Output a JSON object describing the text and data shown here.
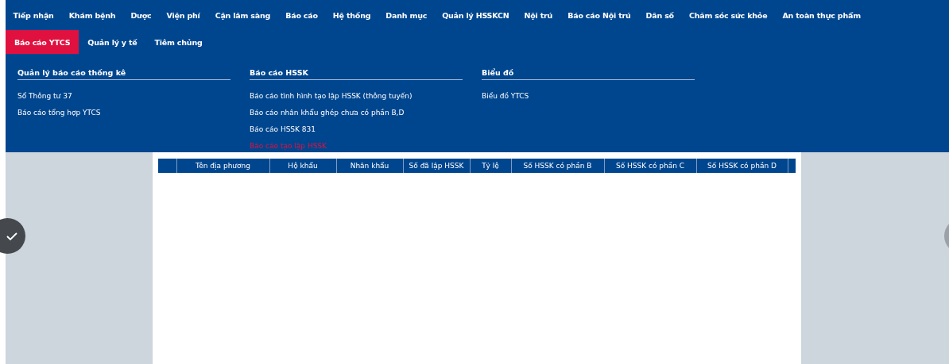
{
  "main_menu": [
    {
      "label": "Tiếp nhận",
      "selected": false
    },
    {
      "label": "Khám bệnh",
      "selected": false
    },
    {
      "label": "Dược",
      "selected": false
    },
    {
      "label": "Viện phí",
      "selected": false
    },
    {
      "label": "Cận lâm sàng",
      "selected": false
    },
    {
      "label": "Báo cáo",
      "selected": false
    },
    {
      "label": "Hệ thống",
      "selected": false
    },
    {
      "label": "Danh mục",
      "selected": false
    },
    {
      "label": "Quản lý HSSKCN",
      "selected": false
    },
    {
      "label": "Nội trú",
      "selected": false
    },
    {
      "label": "Báo cáo Nội trú",
      "selected": false
    },
    {
      "label": "Dân số",
      "selected": false
    },
    {
      "label": "Chăm sóc sức khỏe",
      "selected": false
    },
    {
      "label": "An toàn thực phẩm",
      "selected": false
    }
  ],
  "sub_menu": [
    {
      "label": "Báo cáo YTCS",
      "selected": true
    },
    {
      "label": "Quản lý y tế",
      "selected": false
    },
    {
      "label": "Tiêm chủng",
      "selected": false
    }
  ],
  "groups": [
    {
      "title": "Quản lý báo cáo thống kê",
      "items": [
        {
          "label": "Sổ Thông tư 37",
          "selected": false
        },
        {
          "label": "Báo cáo tổng hợp YTCS",
          "selected": false
        }
      ]
    },
    {
      "title": "Báo cáo HSSK",
      "items": [
        {
          "label": "Báo cáo tình hình tạo lập HSSK (thông tuyến)",
          "selected": false
        },
        {
          "label": "Báo cáo nhân khẩu ghép chưa có phần B,D",
          "selected": false
        },
        {
          "label": "Báo cáo HSSK 831",
          "selected": false
        },
        {
          "label": "Báo cáo tạo lập HSSK",
          "selected": true
        }
      ]
    },
    {
      "title": "Biểu đồ",
      "items": [
        {
          "label": "Biểu đồ YTCS",
          "selected": false
        }
      ]
    }
  ],
  "table": {
    "columns": [
      "Tên địa phương",
      "Hộ khẩu",
      "Nhân khẩu",
      "Số đã lập HSSK",
      "Tỷ lệ",
      "Số HSSK có phần B",
      "Số HSSK có phần C",
      "Số HSSK có phần D"
    ]
  }
}
